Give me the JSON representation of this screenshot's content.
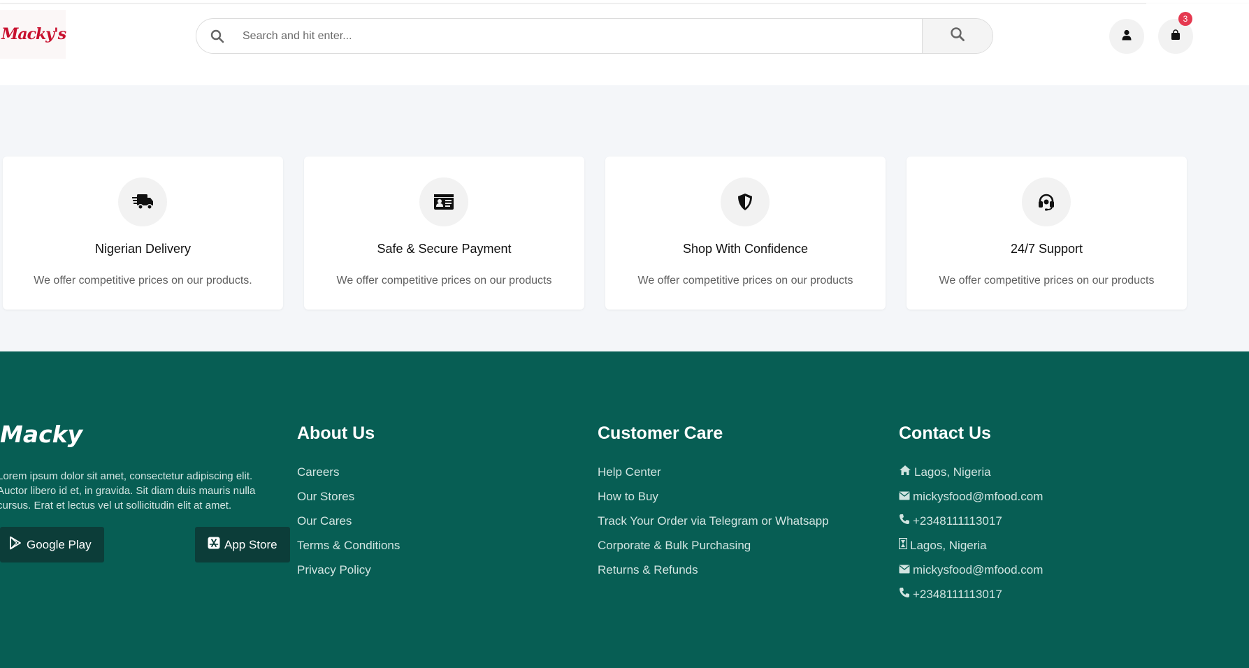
{
  "header": {
    "logo_text": "Macky's",
    "search_placeholder": "Search and hit enter...",
    "cart_count": "3"
  },
  "features": [
    {
      "icon": "delivery-truck-icon",
      "title": "Nigerian Delivery",
      "desc": "We offer competitive prices on our products."
    },
    {
      "icon": "id-card-icon",
      "title": "Safe & Secure Payment",
      "desc": "We offer competitive prices on our products"
    },
    {
      "icon": "shield-icon",
      "title": "Shop With Confidence",
      "desc": "We offer competitive prices on our products"
    },
    {
      "icon": "headset-icon",
      "title": "24/7 Support",
      "desc": "We offer competitive prices on our products"
    }
  ],
  "footer": {
    "brand": "Macky",
    "about_text": "Lorem ipsum dolor sit amet, consectetur adipiscing elit. Auctor libero id et, in gravida. Sit diam duis mauris nulla cursus. Erat et lectus vel ut sollicitudin elit at amet.",
    "google_play": "Google Play",
    "app_store": "App Store",
    "about": {
      "title": "About Us",
      "links": [
        "Careers",
        "Our Stores",
        "Our Cares",
        "Terms & Conditions",
        "Privacy Policy"
      ]
    },
    "care": {
      "title": "Customer Care",
      "links": [
        "Help Center",
        "How to Buy",
        "Track Your Order via Telegram or Whatsapp",
        "Corporate & Bulk Purchasing",
        "Returns & Refunds"
      ]
    },
    "contact": {
      "title": "Contact Us",
      "items": [
        {
          "icon": "home-icon",
          "text": "Lagos, Nigeria"
        },
        {
          "icon": "envelope-icon",
          "text": "mickysfood@mfood.com"
        },
        {
          "icon": "phone-icon",
          "text": "+2348111113017"
        },
        {
          "icon": "hourglass-icon",
          "text": "Lagos, Nigeria"
        },
        {
          "icon": "envelope-icon",
          "text": "mickysfood@mfood.com"
        },
        {
          "icon": "phone-icon",
          "text": "+2348111113017"
        }
      ]
    }
  }
}
